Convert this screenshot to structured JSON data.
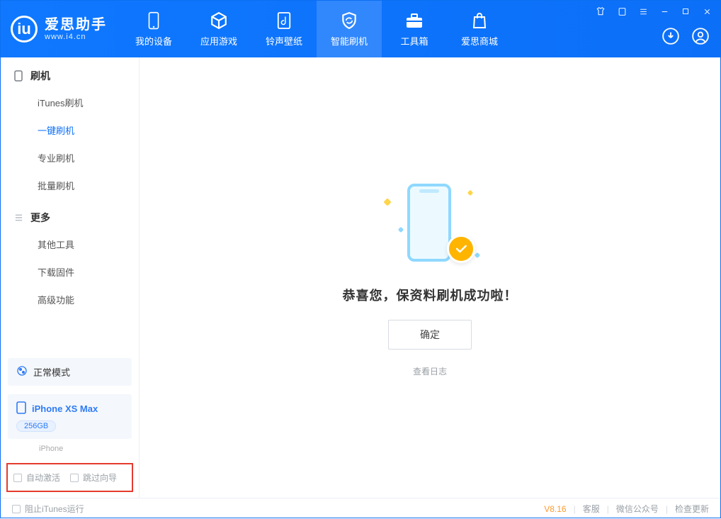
{
  "app": {
    "name_cn": "爱思助手",
    "url": "www.i4.cn"
  },
  "top_tabs": [
    {
      "label": "我的设备"
    },
    {
      "label": "应用游戏"
    },
    {
      "label": "铃声壁纸"
    },
    {
      "label": "智能刷机",
      "active": true
    },
    {
      "label": "工具箱"
    },
    {
      "label": "爱思商城"
    }
  ],
  "sidebar": {
    "section1": {
      "title": "刷机"
    },
    "items1": [
      {
        "label": "iTunes刷机"
      },
      {
        "label": "一键刷机",
        "active": true
      },
      {
        "label": "专业刷机"
      },
      {
        "label": "批量刷机"
      }
    ],
    "section2": {
      "title": "更多"
    },
    "items2": [
      {
        "label": "其他工具"
      },
      {
        "label": "下载固件"
      },
      {
        "label": "高级功能"
      }
    ],
    "mode_label": "正常模式",
    "device": {
      "name": "iPhone XS Max",
      "capacity": "256GB",
      "type": "iPhone"
    },
    "opts": {
      "auto_activate": "自动激活",
      "skip_guide": "跳过向导"
    }
  },
  "main": {
    "success_text": "恭喜您，保资料刷机成功啦！",
    "ok_label": "确定",
    "view_log": "查看日志"
  },
  "statusbar": {
    "block_itunes": "阻止iTunes运行",
    "version": "V8.16",
    "links": [
      "客服",
      "微信公众号",
      "检查更新"
    ]
  }
}
